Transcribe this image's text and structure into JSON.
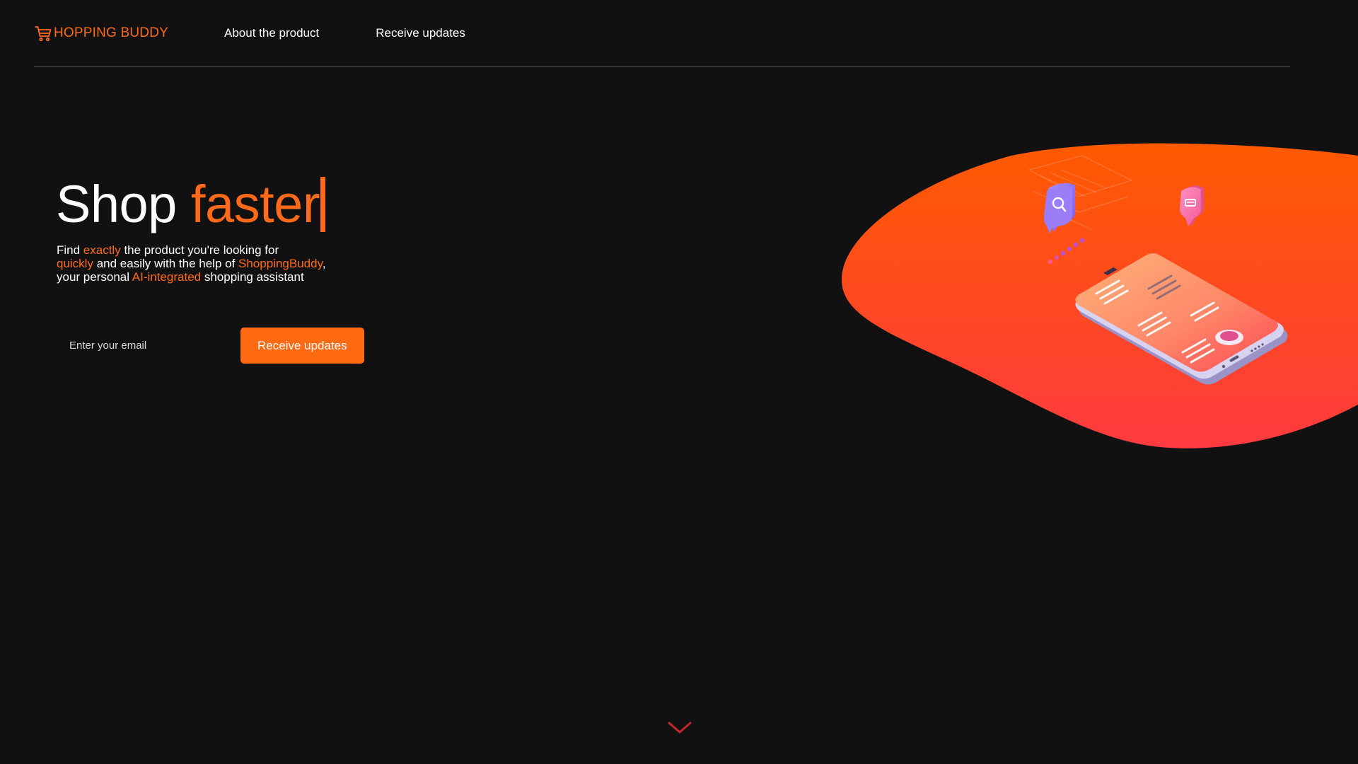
{
  "brand": {
    "name": "HOPPING BUDDY",
    "icon": "shopping-cart-icon",
    "color": "#ff6a1a"
  },
  "nav": {
    "items": [
      {
        "label": "About the product"
      },
      {
        "label": "Receive updates"
      }
    ]
  },
  "hero": {
    "title_main": "Shop",
    "title_accent": "faster",
    "description": {
      "p1": "Find ",
      "h1": "exactly",
      "p2": " the product you're looking for",
      "h2": "quickly",
      "p3": " and easily with the help of ",
      "h3": "ShoppingBuddy",
      "p4": ",",
      "p5": "your personal ",
      "h4": "AI-integrated",
      "p6": " shopping assistant"
    }
  },
  "signup": {
    "email_placeholder": "Enter your email",
    "email_value": "",
    "button_label": "Receive updates"
  },
  "illustration": {
    "description_icons": [
      "search-bubble-icon",
      "cart-bubble-icon",
      "smartphone-icon"
    ]
  },
  "scroll_indicator": {
    "icon": "chevron-down-icon"
  },
  "colors": {
    "background": "#111111",
    "accent": "#ff6a1a",
    "button": "#ff6a13",
    "blob_top": "#ff5a00",
    "blob_bottom": "#ff3a3d",
    "divider": "#5a5a5a"
  }
}
